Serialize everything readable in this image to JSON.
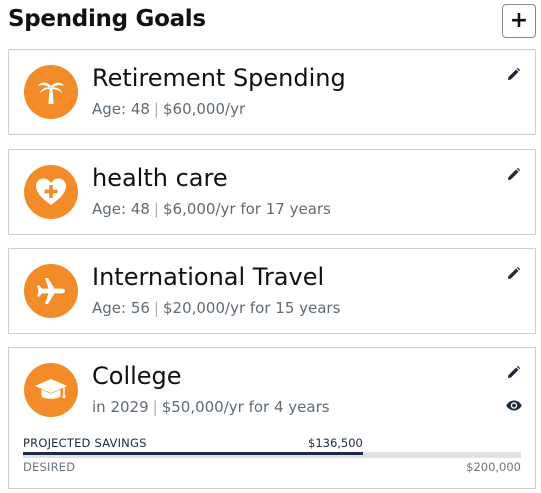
{
  "header": {
    "title": "Spending Goals",
    "add_label": "+"
  },
  "goals": [
    {
      "name": "Retirement Spending",
      "detail_a": "Age: 48",
      "detail_b": "$60,000/yr",
      "icon": "palm-tree-icon"
    },
    {
      "name": "health care",
      "detail_a": "Age: 48",
      "detail_b": "$6,000/yr for 17 years",
      "icon": "heart-plus-icon"
    },
    {
      "name": "International Travel",
      "detail_a": "Age: 56",
      "detail_b": "$20,000/yr for 15 years",
      "icon": "airplane-icon"
    },
    {
      "name": "College",
      "detail_a": "in 2029",
      "detail_b": "$50,000/yr for 4 years",
      "icon": "graduation-cap-icon",
      "savings": {
        "projected_label": "PROJECTED SAVINGS",
        "projected_value": "$136,500",
        "desired_label": "DESIRED",
        "desired_value": "$200,000",
        "progress_fraction": 0.6825
      }
    }
  ],
  "colors": {
    "accent": "#f28c28",
    "progress": "#1b2b4b",
    "track": "#dfe3e6"
  }
}
